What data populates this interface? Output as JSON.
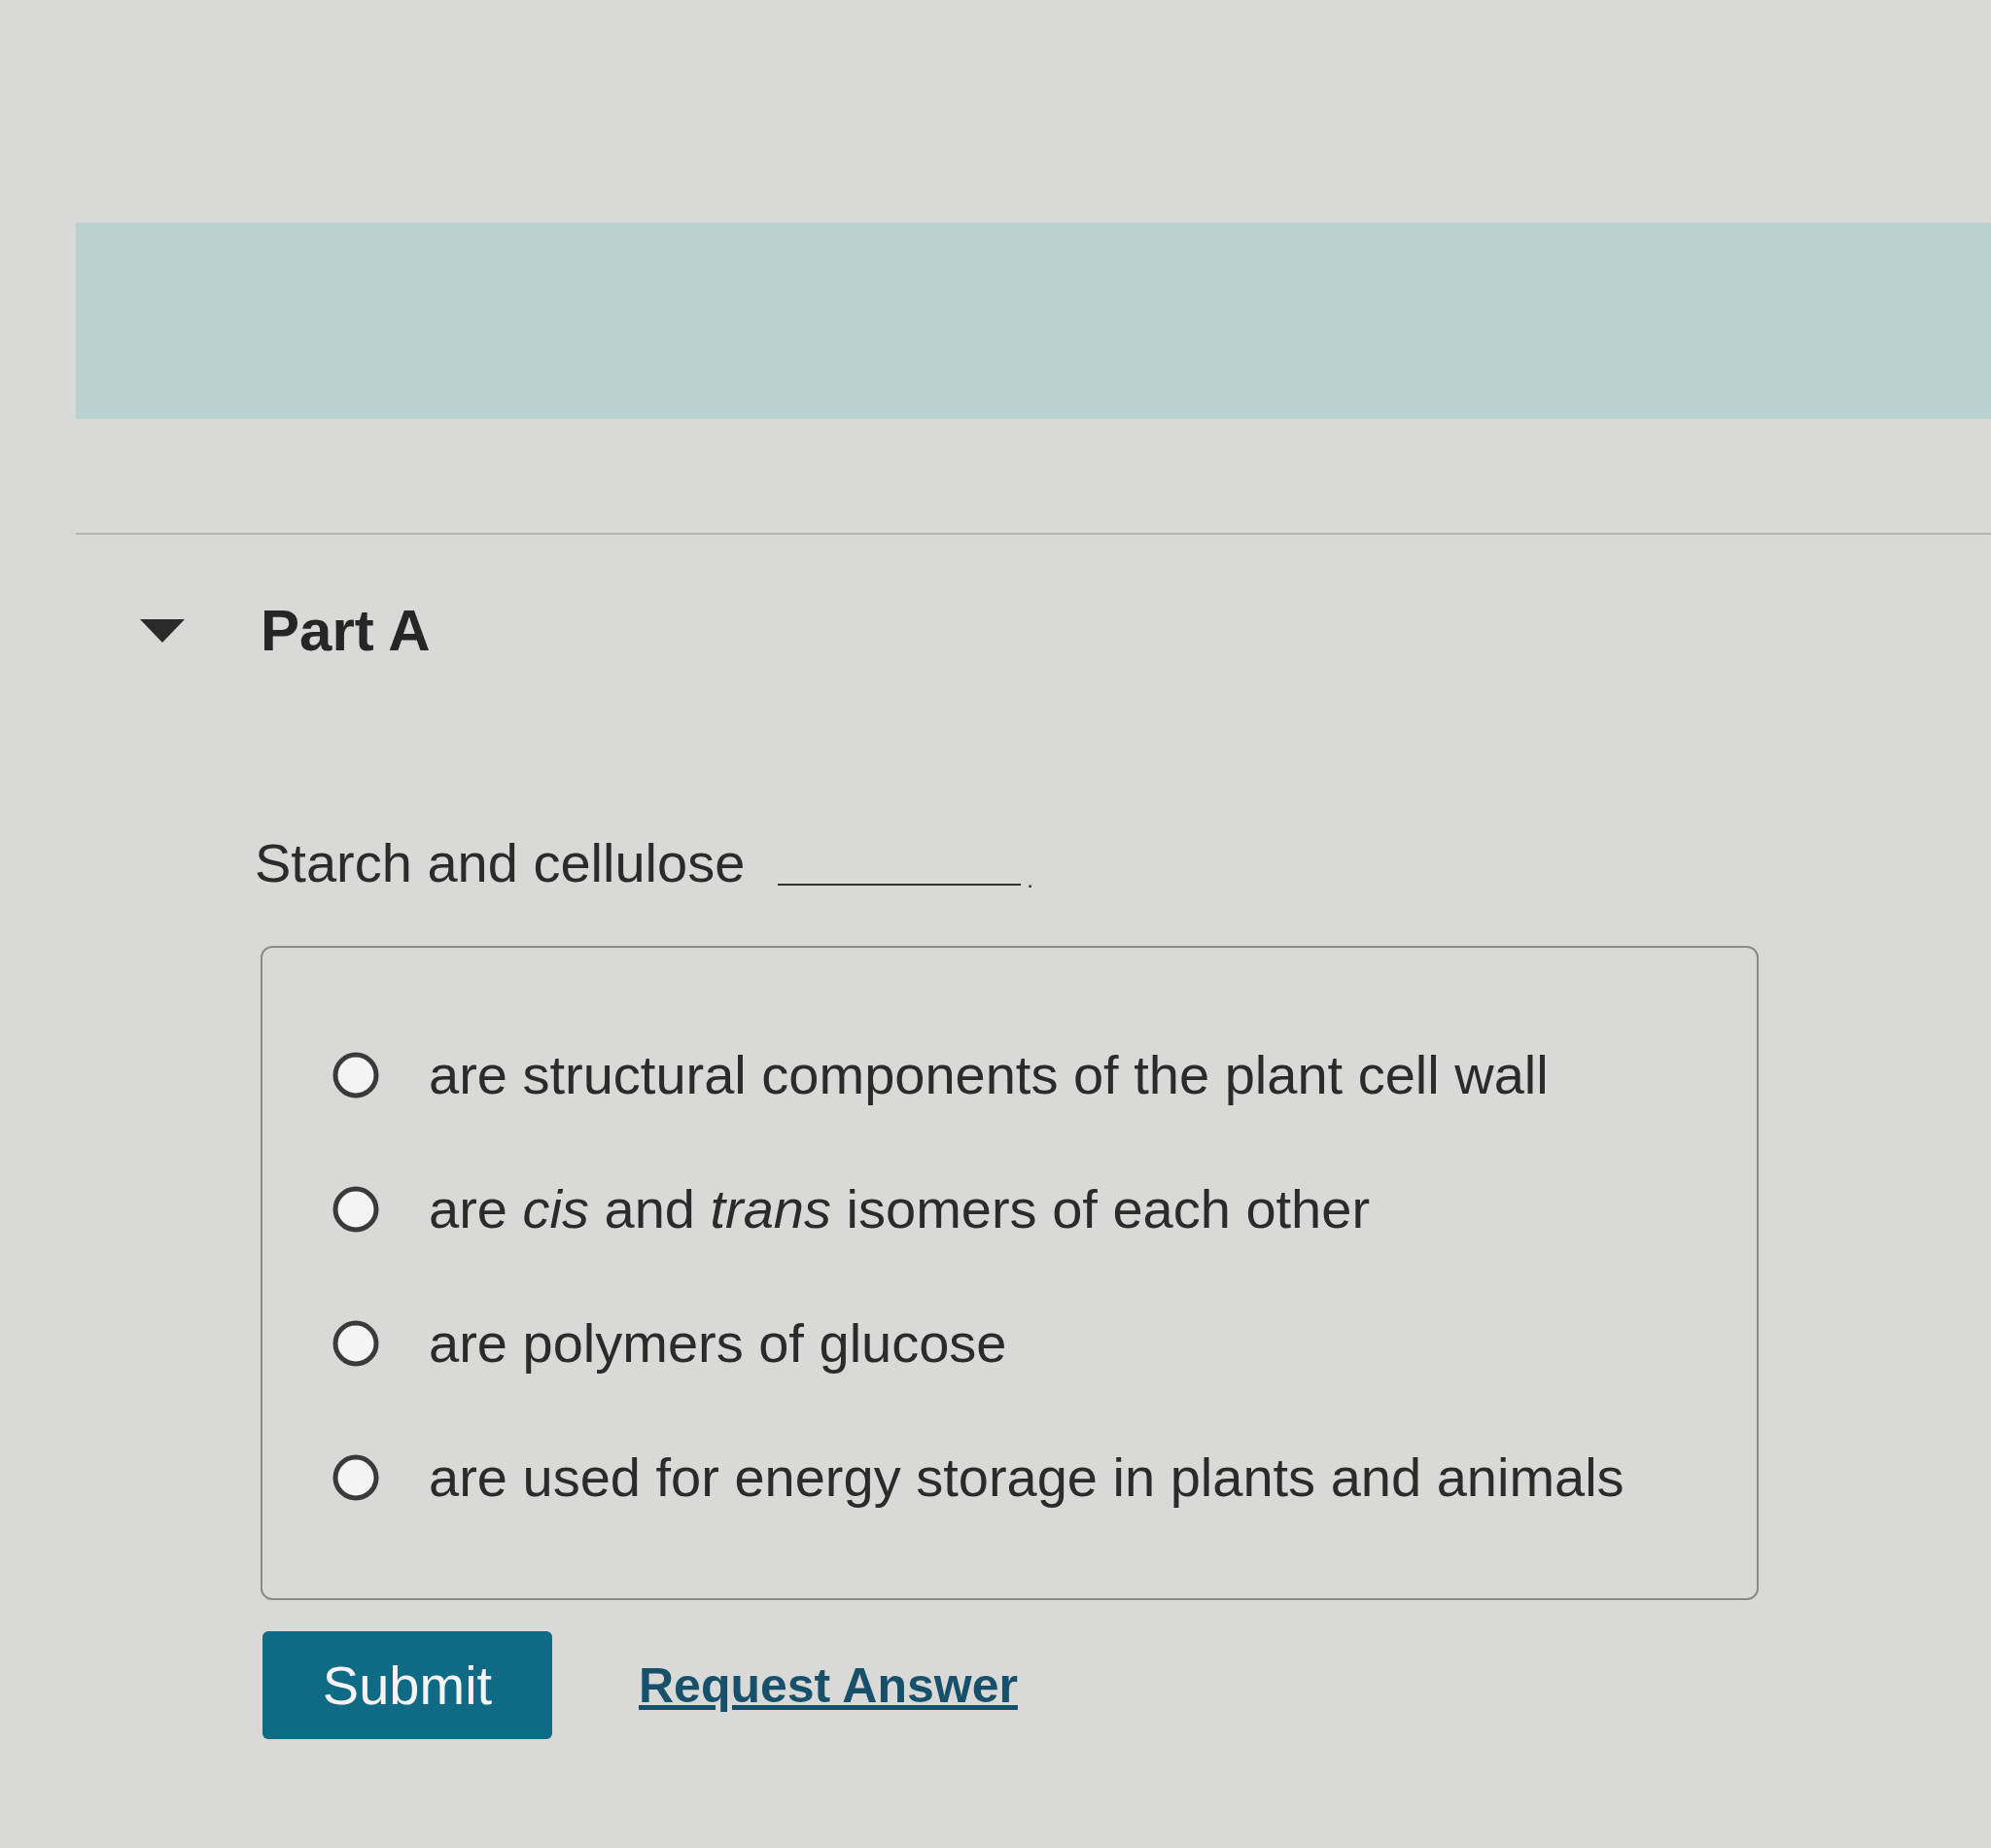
{
  "part": {
    "title": "Part A",
    "expanded": true
  },
  "question": {
    "text": "Starch and cellulose",
    "end": "."
  },
  "options": [
    {
      "text": "are structural components of the plant cell wall",
      "selected": false
    },
    {
      "text": "are *cis* and *trans* isomers of each other",
      "selected": false
    },
    {
      "text": "are polymers of glucose",
      "selected": false
    },
    {
      "text": "are used for energy storage in plants and animals",
      "selected": false
    }
  ],
  "actions": {
    "submit": "Submit",
    "request_answer": "Request Answer"
  }
}
